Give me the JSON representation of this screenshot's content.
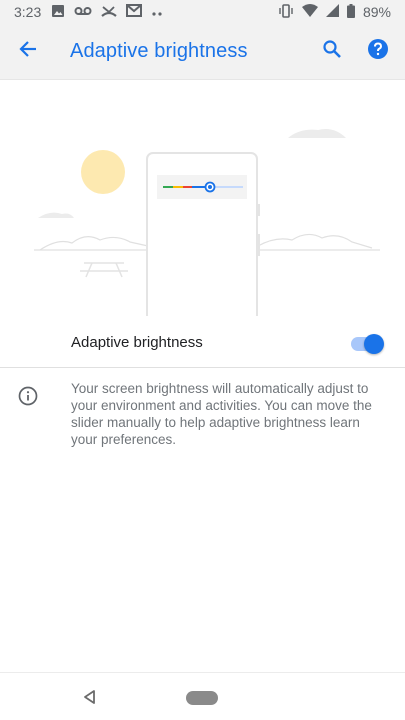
{
  "status_bar": {
    "time": "3:23",
    "left_icons": [
      "image-icon",
      "voicemail-icon",
      "missed-call-icon",
      "gmail-icon",
      "more-notifications-icon"
    ],
    "right_icons": [
      "vibrate-icon",
      "wifi-icon",
      "cell-signal-icon",
      "battery-icon"
    ],
    "battery": "89%"
  },
  "app_bar": {
    "title": "Adaptive brightness",
    "accent_color": "#1a73e8"
  },
  "illustration": {
    "slider_colors": [
      "#34a853",
      "#fbbc04",
      "#ea4335",
      "#1a73e8"
    ],
    "sun_color": "#fde9b0"
  },
  "setting": {
    "label": "Adaptive brightness",
    "enabled": true
  },
  "info": {
    "text": "Your screen brightness will automatically adjust to your environment and activities. You can move the slider manually to help adaptive brightness learn your preferences."
  }
}
